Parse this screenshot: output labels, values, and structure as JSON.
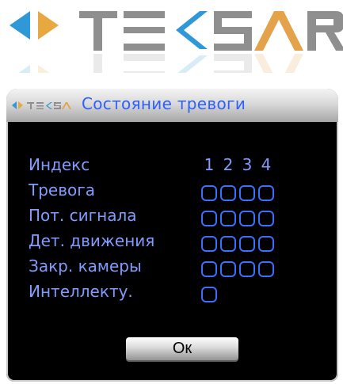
{
  "brand": {
    "logo_text": "TE<SAR",
    "colors": {
      "arrow_left": "#2f98d6",
      "arrow_right": "#e7a83f",
      "letters": "#8f8f8f",
      "accent_a": "#e4a24b"
    }
  },
  "dialog": {
    "title": "Состояние тревоги",
    "title_logo_text": "TE<SAR",
    "colors": {
      "title": "#2d5fff",
      "labels": "#7f9cff",
      "checkbox_border": "#3e6dff",
      "background": "#000000"
    },
    "channel_header": {
      "label": "Индекс",
      "channels": [
        "1",
        "2",
        "3",
        "4"
      ]
    },
    "rows": [
      {
        "label": "Тревога",
        "states": [
          false,
          false,
          false,
          false
        ]
      },
      {
        "label": "Пот. сигнала",
        "states": [
          false,
          false,
          false,
          false
        ]
      },
      {
        "label": "Дет. движения",
        "states": [
          false,
          false,
          false,
          false
        ]
      },
      {
        "label": "Закр. камеры",
        "states": [
          false,
          false,
          false,
          false
        ]
      },
      {
        "label": "Интеллекту.",
        "states": [
          false
        ]
      }
    ],
    "ok_label": "Ок"
  }
}
